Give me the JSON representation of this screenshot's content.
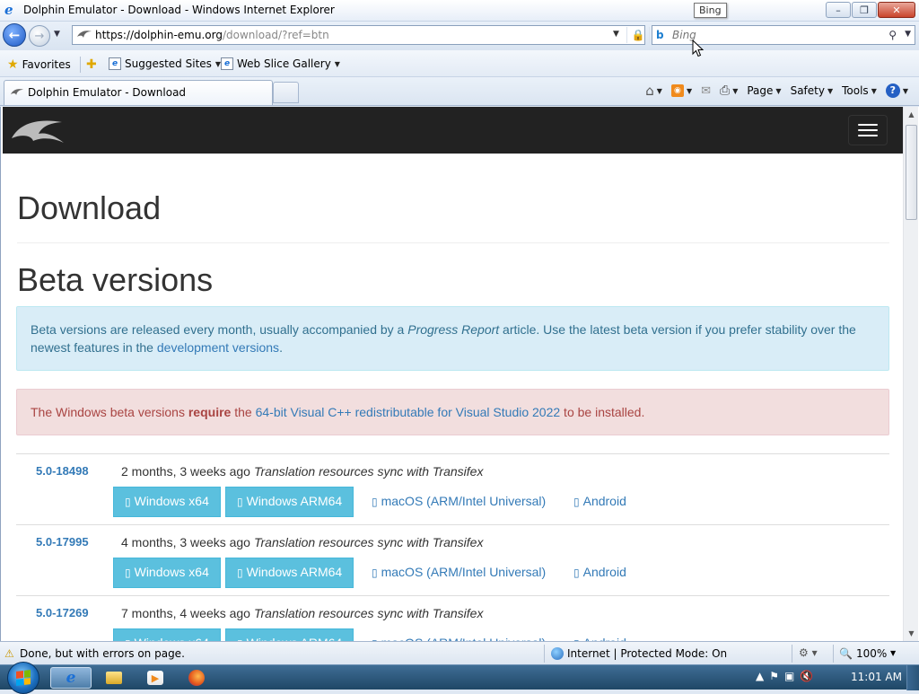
{
  "window": {
    "title": "Dolphin Emulator - Download - Windows Internet Explorer",
    "controls": {
      "minimize": "–",
      "maximize": "❐",
      "close": "✕"
    }
  },
  "tooltip": "Bing",
  "navigation": {
    "back": "←",
    "forward": "→",
    "url_main": "https://dolphin-emu.org",
    "url_rest": "/download/?ref=btn",
    "search_placeholder": "Bing"
  },
  "favorites_bar": {
    "favorites": "Favorites",
    "suggested_sites": "Suggested Sites",
    "web_slice_gallery": "Web Slice Gallery"
  },
  "tab": {
    "label": "Dolphin Emulator - Download"
  },
  "command_bar": {
    "page": "Page",
    "safety": "Safety",
    "tools": "Tools"
  },
  "site": {
    "heading_download": "Download",
    "heading_beta": "Beta versions",
    "info_alert": {
      "text_1": "Beta versions are released every month, usually accompanied by a ",
      "emphasis": "Progress Report",
      "text_2": " article. Use the latest beta version if you prefer stability over the newest features in the ",
      "link": "development versions",
      "text_3": "."
    },
    "danger_alert": {
      "text_1": "The Windows beta versions ",
      "bold": "require",
      "text_2": " the ",
      "link": "64-bit Visual C++ redistributable for Visual Studio 2022",
      "text_3": " to be installed."
    },
    "buttons": {
      "windows_x64": "Windows x64",
      "windows_arm64": "Windows ARM64",
      "macos": "macOS (ARM/Intel Universal)",
      "android": "Android",
      "glyph": "▯"
    },
    "releases": [
      {
        "version": "5.0-18498",
        "age": "2 months, 3 weeks ago",
        "message": "Translation resources sync with Transifex"
      },
      {
        "version": "5.0-17995",
        "age": "4 months, 3 weeks ago",
        "message": "Translation resources sync with Transifex"
      },
      {
        "version": "5.0-17269",
        "age": "7 months, 4 weeks ago",
        "message": "Translation resources sync with Transifex"
      }
    ]
  },
  "status_bar": {
    "status": "Done, but with errors on page.",
    "zone": "Internet | Protected Mode: On",
    "zoom": "100%"
  },
  "taskbar": {
    "clock": "11:01 AM"
  }
}
